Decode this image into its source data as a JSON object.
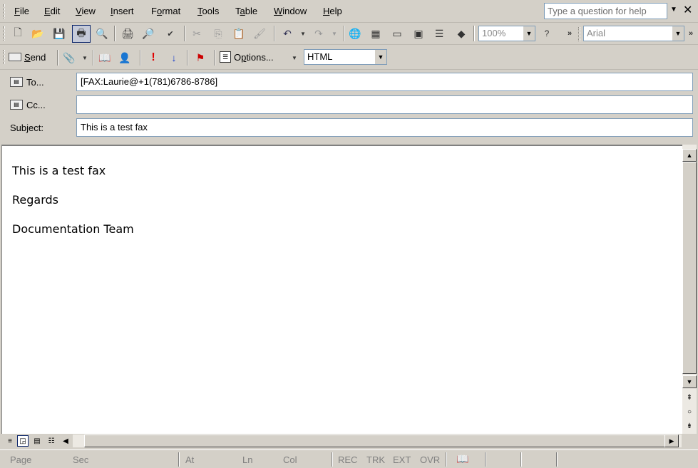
{
  "menu": {
    "items": [
      "File",
      "Edit",
      "View",
      "Insert",
      "Format",
      "Tools",
      "Table",
      "Window",
      "Help"
    ],
    "underlined": [
      "F",
      "E",
      "V",
      "I",
      "o",
      "T",
      "a",
      "W",
      "H"
    ],
    "rest": [
      "ile",
      "dit",
      "iew",
      "nsert",
      "rmat",
      "ools",
      "ble",
      "indow",
      "elp"
    ],
    "prefix": [
      "",
      "",
      "",
      "",
      "F",
      "",
      "T",
      "",
      ""
    ],
    "help_placeholder": "Type a question for help"
  },
  "toolbar1": {
    "zoom_value": "100%",
    "font_value": "Arial"
  },
  "toolbar2": {
    "send_label": "Send",
    "send_underline": "S",
    "send_rest": "end",
    "options_label": "Options...",
    "options_prefix": "O",
    "options_underline": "p",
    "options_rest": "tions...",
    "format_value": "HTML"
  },
  "header": {
    "to_label": "To...",
    "cc_label": "Cc...",
    "subject_label": "Subject:",
    "to_value": "[FAX:Laurie@+1(781)6786-8786]",
    "cc_value": "",
    "subject_value": "This is a test fax"
  },
  "body": {
    "lines": [
      "This is a test fax",
      "Regards",
      "Documentation Team"
    ]
  },
  "status": {
    "page": "Page",
    "sec": "Sec",
    "at": "At",
    "ln": "Ln",
    "col": "Col",
    "rec": "REC",
    "trk": "TRK",
    "ext": "EXT",
    "ovr": "OVR"
  }
}
